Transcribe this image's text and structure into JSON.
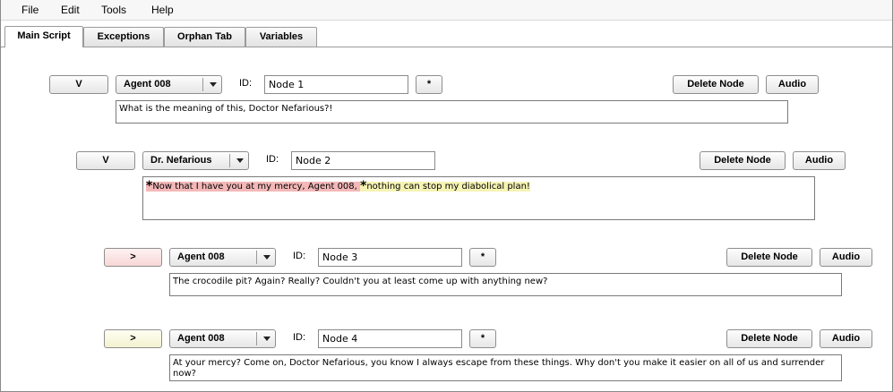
{
  "menu": [
    "File",
    "Edit",
    "Tools",
    "Help"
  ],
  "tabs": [
    "Main Script",
    "Exceptions",
    "Orphan Tab",
    "Variables"
  ],
  "active_tab": "Main Script",
  "labels": {
    "id": "ID:",
    "star": "*",
    "delete": "Delete Node",
    "audio": "Audio"
  },
  "colors": {
    "toggle_pink": "#f8d6d6",
    "toggle_cream": "#f3f1cf",
    "highlight_pink": "#f4b8b8",
    "highlight_yellow": "#f6f3b4"
  },
  "nodes": [
    {
      "toggle": "V",
      "speaker": "Agent 008",
      "id": "Node 1",
      "text": "What is the meaning of this, Doctor Nefarious?!"
    },
    {
      "toggle": "V",
      "speaker": "Dr. Nefarious",
      "id": "Node 2",
      "segments": [
        {
          "marker": "*",
          "text": "Now that I have you at my mercy, Agent 008, "
        },
        {
          "marker": "*",
          "text": "nothing can stop my diabolical plan!"
        }
      ]
    },
    {
      "toggle": ">",
      "speaker": "Agent 008",
      "id": "Node 3",
      "text": "The crocodile pit? Again? Really? Couldn't you at least come up with anything new?"
    },
    {
      "toggle": ">",
      "speaker": "Agent 008",
      "id": "Node 4",
      "text": "At your mercy? Come on, Doctor Nefarious, you know I always escape from these things. Why don't you make it easier on all of us and surrender now?"
    }
  ]
}
